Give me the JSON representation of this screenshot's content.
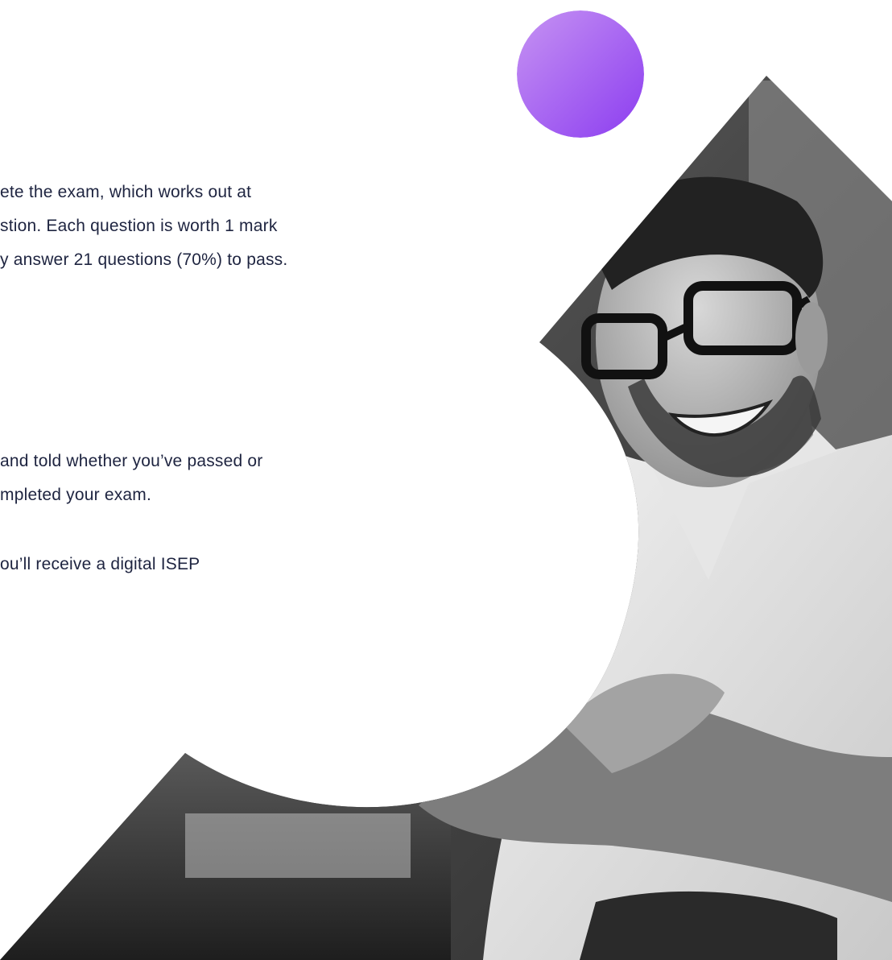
{
  "colors": {
    "accent_gradient_start": "#c08cf2",
    "accent_gradient_end": "#8f42f0",
    "text": "#1e2440",
    "photo_dark": "#3a3a3a",
    "photo_light": "#d9d9d9"
  },
  "exam_info": {
    "paragraph_1": [
      "ete the exam, which works out at",
      "stion. Each question is worth 1 mark",
      "y answer 21 questions (70%) to pass."
    ],
    "paragraph_2": [
      "and told whether you’ve passed or",
      "mpleted your exam."
    ],
    "paragraph_3": [
      "ou’ll receive a digital ISEP"
    ]
  },
  "images": {
    "hero_photo": "smiling-man-handshake-photo",
    "accent": "purple-circle"
  }
}
